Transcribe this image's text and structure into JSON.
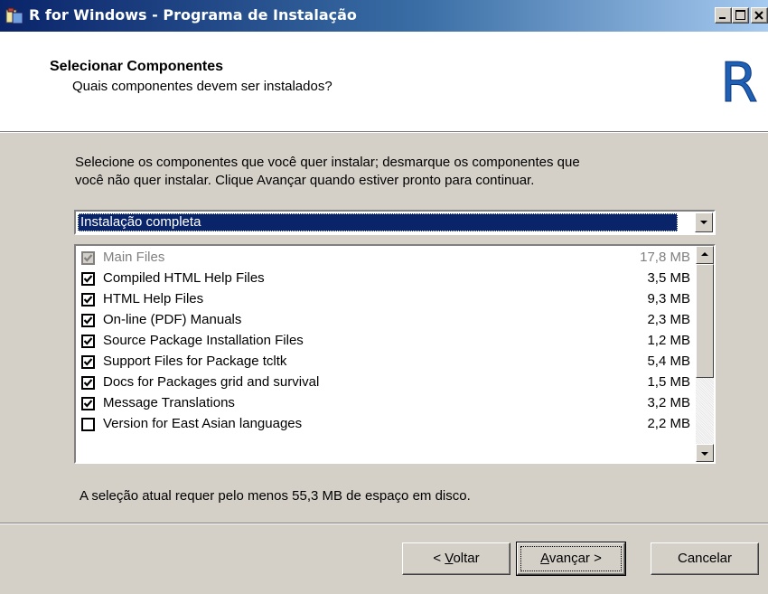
{
  "window": {
    "title": "R for Windows - Programa de Instalação",
    "app_icon": "installer-icon",
    "controls": [
      "minimize-icon",
      "maximize-icon",
      "close-icon"
    ]
  },
  "header": {
    "title": "Selecionar Componentes",
    "subtitle": "Quais componentes devem ser instalados?",
    "logo": "R"
  },
  "body": {
    "description_line1": "Selecione os componentes que você quer instalar; desmarque os componentes que",
    "description_line2": "você não quer instalar. Clique Avançar quando estiver pronto para continuar.",
    "install_type": "Instalação completa",
    "components": [
      {
        "label": "Main Files",
        "size": "17,8 MB",
        "checked": true,
        "disabled": true
      },
      {
        "label": "Compiled HTML Help Files",
        "size": "3,5 MB",
        "checked": true,
        "disabled": false
      },
      {
        "label": "HTML Help Files",
        "size": "9,3 MB",
        "checked": true,
        "disabled": false
      },
      {
        "label": "On-line (PDF) Manuals",
        "size": "2,3 MB",
        "checked": true,
        "disabled": false
      },
      {
        "label": "Source Package Installation Files",
        "size": "1,2 MB",
        "checked": true,
        "disabled": false
      },
      {
        "label": "Support Files for Package tcltk",
        "size": "5,4 MB",
        "checked": true,
        "disabled": false
      },
      {
        "label": "Docs for Packages grid and survival",
        "size": "1,5 MB",
        "checked": true,
        "disabled": false
      },
      {
        "label": "Message Translations",
        "size": "3,2 MB",
        "checked": true,
        "disabled": false
      },
      {
        "label": "Version for East Asian languages",
        "size": "2,2 MB",
        "checked": false,
        "disabled": false
      }
    ],
    "space_note": "A seleção atual requer pelo menos 55,3 MB de espaço em disco."
  },
  "buttons": {
    "back_prefix": "< ",
    "back_key": "V",
    "back_rest": "oltar",
    "next_key": "A",
    "next_rest": "vançar >",
    "cancel": "Cancelar"
  },
  "colors": {
    "face": "#d4d0c8",
    "titlebar_start": "#0a246a",
    "titlebar_end": "#a6caf0",
    "selection": "#0a246a",
    "logo": "#1f5fb4"
  }
}
